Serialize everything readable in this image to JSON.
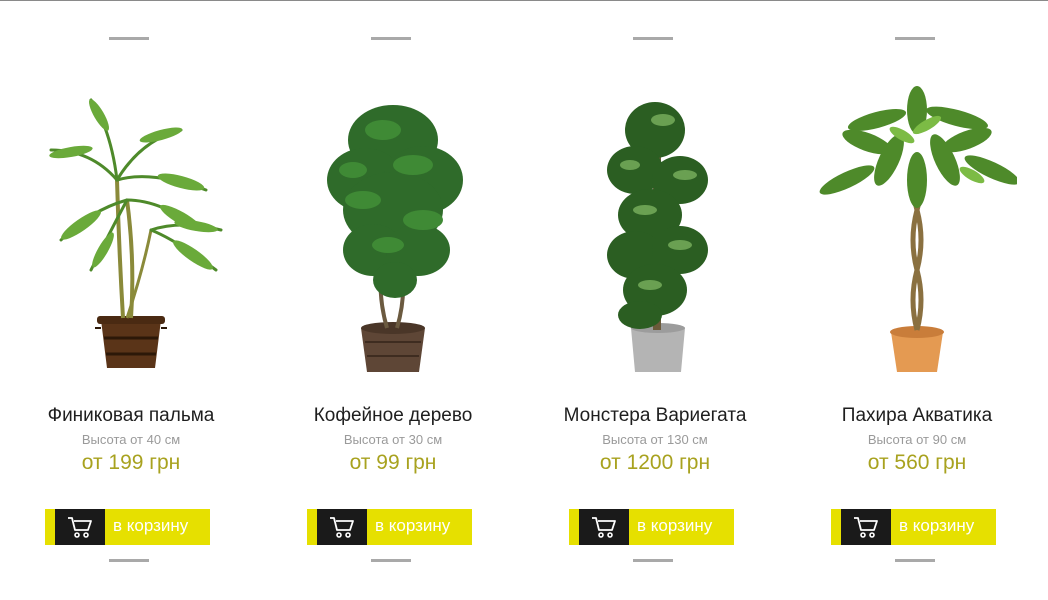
{
  "products": [
    {
      "name": "Финиковая пальма",
      "height": "Высота от 40 см",
      "price": "от 199 грн",
      "button_label": "в корзину"
    },
    {
      "name": "Кофейное дерево",
      "height": "Высота от 30 см",
      "price": "от 99 грн",
      "button_label": "в корзину"
    },
    {
      "name": "Монстера Вариегата",
      "height": "Высота от 130 см",
      "price": "от 1200 грн",
      "button_label": "в корзину"
    },
    {
      "name": "Пахира Акватика",
      "height": "Высота от 90 см",
      "price": "от 560 грн",
      "button_label": "в корзину"
    }
  ],
  "icons": {
    "cart": "shopping-cart-icon"
  },
  "colors": {
    "price": "#a8a21f",
    "button": "#e6e000",
    "icon_box": "#1a1a1a"
  }
}
